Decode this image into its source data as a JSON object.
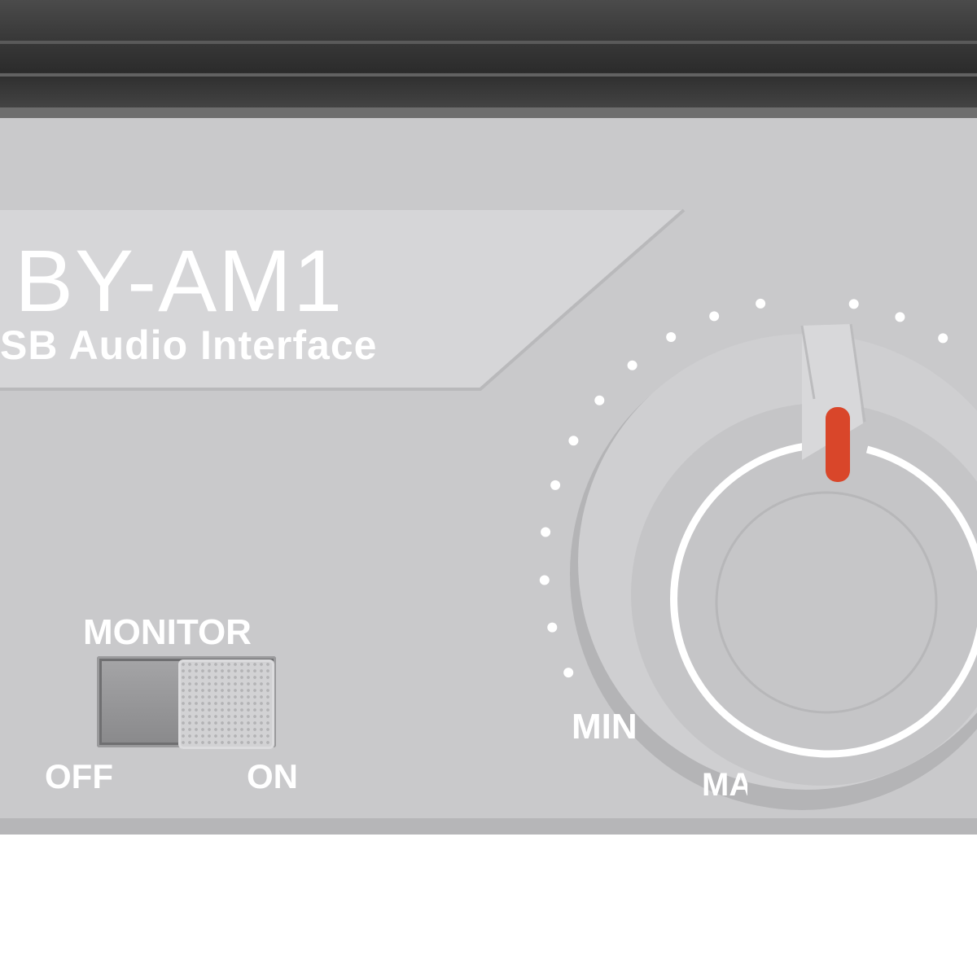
{
  "device": {
    "model_name": "BY-AM1",
    "subtitle": "SB Audio Interface",
    "panel_color": "#c9c9cb",
    "top_cover_color": "#3a3a3a",
    "label_color": "#ffffff"
  },
  "monitor_switch": {
    "title": "MONITOR",
    "off_label": "OFF",
    "on_label": "ON",
    "state": "ON"
  },
  "volume_knob": {
    "min_label": "MIN",
    "max_label": "MA",
    "indicator_color": "#d9462a",
    "icon": "rotary-knob-icon"
  }
}
